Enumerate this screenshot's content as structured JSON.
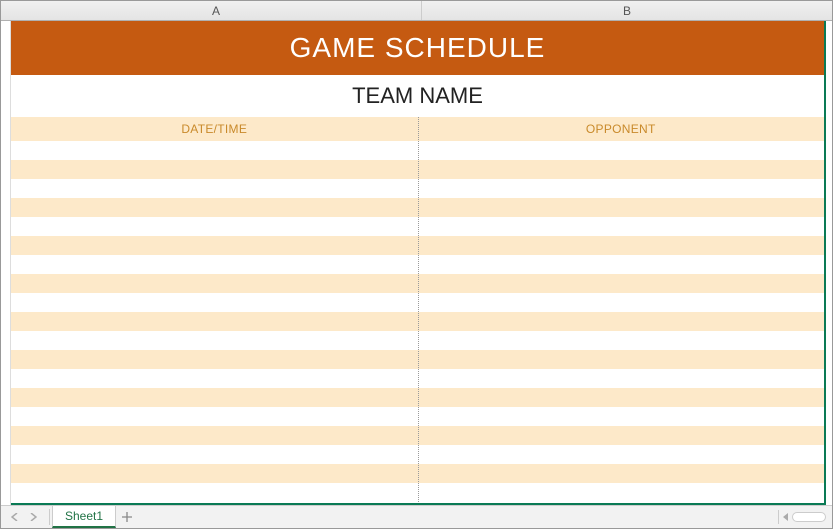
{
  "columns": {
    "A": "A",
    "B": "B"
  },
  "title": "GAME SCHEDULE",
  "subtitle": "TEAM NAME",
  "headers": {
    "A": "DATE/TIME",
    "B": "OPPONENT"
  },
  "rows": [
    {
      "A": "",
      "B": ""
    },
    {
      "A": "",
      "B": ""
    },
    {
      "A": "",
      "B": ""
    },
    {
      "A": "",
      "B": ""
    },
    {
      "A": "",
      "B": ""
    },
    {
      "A": "",
      "B": ""
    },
    {
      "A": "",
      "B": ""
    },
    {
      "A": "",
      "B": ""
    },
    {
      "A": "",
      "B": ""
    },
    {
      "A": "",
      "B": ""
    },
    {
      "A": "",
      "B": ""
    },
    {
      "A": "",
      "B": ""
    },
    {
      "A": "",
      "B": ""
    },
    {
      "A": "",
      "B": ""
    },
    {
      "A": "",
      "B": ""
    },
    {
      "A": "",
      "B": ""
    },
    {
      "A": "",
      "B": ""
    },
    {
      "A": "",
      "B": ""
    },
    {
      "A": "",
      "B": ""
    }
  ],
  "tabs": {
    "active": "Sheet1"
  },
  "colors": {
    "accent": "#c55a11",
    "stripe": "#fde9c9",
    "header_text": "#c98a2b",
    "excel_green": "#217346"
  }
}
